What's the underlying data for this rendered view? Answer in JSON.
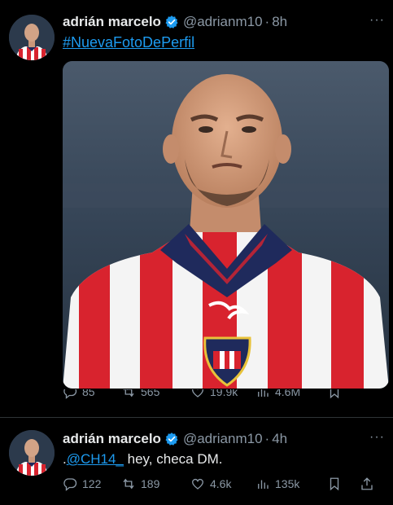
{
  "tweets": [
    {
      "name": "adrián marcelo",
      "handle": "@adrianm10",
      "time": "8h",
      "text": "#NuevaFotoDePerfil",
      "actions": {
        "replies": "85",
        "retweets": "565",
        "likes": "19.9k",
        "views": "4.6M"
      }
    },
    {
      "name": "adrián marcelo",
      "handle": "@adrianm10",
      "time": "4h",
      "text_prefix": ".",
      "mention": "@CH14_",
      "text_suffix": " hey, checa DM.",
      "actions": {
        "replies": "122",
        "retweets": "189",
        "likes": "4.6k",
        "views": "135k"
      }
    }
  ],
  "icons": {
    "verified": "verified-badge-icon",
    "more": "more-dots-icon",
    "reply": "reply-icon",
    "retweet": "retweet-icon",
    "like": "heart-icon",
    "views": "views-chart-icon",
    "bookmark": "bookmark-icon",
    "share": "share-icon"
  },
  "colors": {
    "accent": "#1d9bf0",
    "muted": "#8b98a5",
    "background": "#000000",
    "jersey_red": "#d8232e",
    "jersey_navy": "#1f2a5c"
  },
  "more_label": "···",
  "dot_label": "·"
}
